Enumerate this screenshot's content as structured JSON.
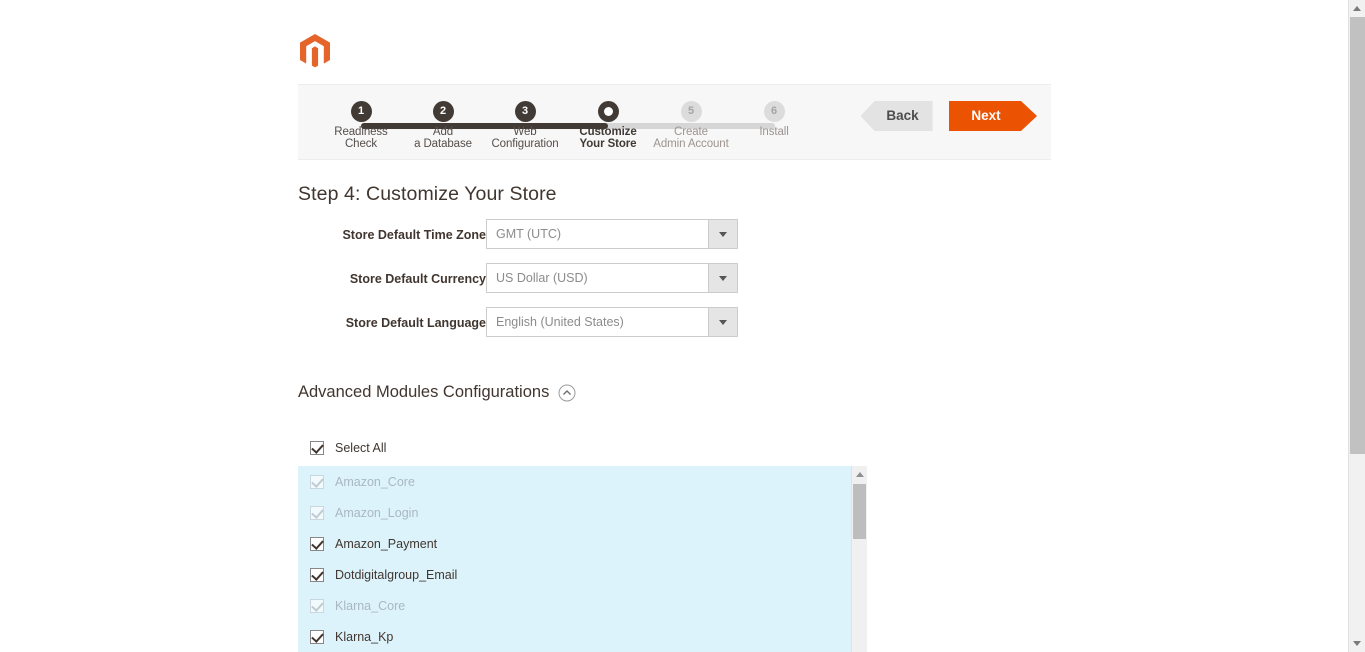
{
  "brand": {
    "logo_icon": "magento-logo-icon",
    "accent_color": "#eb5202"
  },
  "wizard": {
    "steps": [
      {
        "number": "1",
        "line1": "Readiness",
        "line2": "Check",
        "state": "done"
      },
      {
        "number": "2",
        "line1": "Add",
        "line2": "a Database",
        "state": "done"
      },
      {
        "number": "3",
        "line1": "Web",
        "line2": "Configuration",
        "state": "done"
      },
      {
        "number": "4",
        "line1": "Customize",
        "line2": "Your Store",
        "state": "current"
      },
      {
        "number": "5",
        "line1": "Create",
        "line2": "Admin Account",
        "state": "todo"
      },
      {
        "number": "6",
        "line1": "Install",
        "line2": "",
        "state": "todo"
      }
    ],
    "back_label": "Back",
    "next_label": "Next"
  },
  "main": {
    "title": "Step 4: Customize Your Store",
    "fields": [
      {
        "label": "Store Default Time Zone",
        "required_marker": "*",
        "value": "GMT (UTC)",
        "icon": "chevron-down-icon"
      },
      {
        "label": "Store Default Currency",
        "required_marker": "*",
        "value": "US Dollar (USD)",
        "icon": "chevron-down-icon"
      },
      {
        "label": "Store Default Language",
        "required_marker": "*",
        "value": "English (United States)",
        "icon": "chevron-down-icon"
      }
    ]
  },
  "advanced": {
    "title": "Advanced Modules Configurations",
    "collapse_icon": "chevron-up-circle-icon",
    "select_all_label": "Select All",
    "select_all_checked": true,
    "modules": [
      {
        "label": "Amazon_Core",
        "checked": true,
        "disabled": true
      },
      {
        "label": "Amazon_Login",
        "checked": true,
        "disabled": true
      },
      {
        "label": "Amazon_Payment",
        "checked": true,
        "disabled": false
      },
      {
        "label": "Dotdigitalgroup_Email",
        "checked": true,
        "disabled": false
      },
      {
        "label": "Klarna_Core",
        "checked": true,
        "disabled": true
      },
      {
        "label": "Klarna_Kp",
        "checked": true,
        "disabled": false
      }
    ]
  },
  "scrollbars": {
    "module_list_up_icon": "scroll-up-arrow-icon",
    "page_up_icon": "scroll-up-arrow-icon",
    "page_down_icon": "scroll-down-arrow-icon"
  }
}
